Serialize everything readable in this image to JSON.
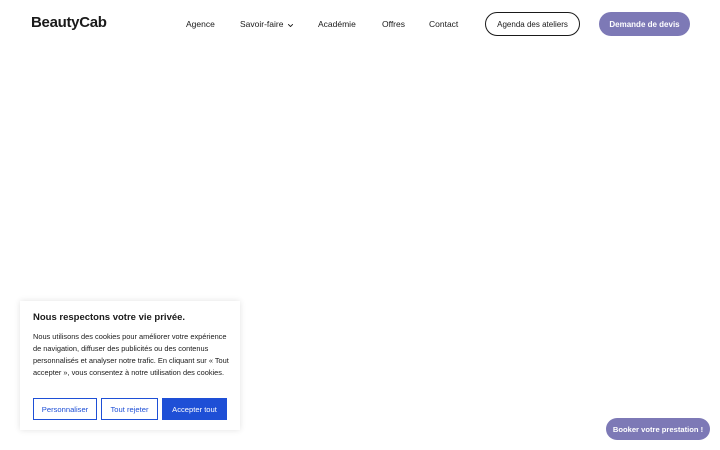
{
  "header": {
    "logo": "BeautyCab",
    "nav": {
      "agence": "Agence",
      "savoir_faire": "Savoir-faire",
      "academie": "Académie",
      "offres": "Offres",
      "contact": "Contact"
    },
    "agenda_button": "Agenda des ateliers",
    "devis_button": "Demande de devis"
  },
  "cookie_banner": {
    "title": "Nous respectons votre vie privée.",
    "text": "Nous utilisons des cookies pour améliorer votre expérience de navigation, diffuser des publicités ou des contenus personnalisés et analyser notre trafic. En cliquant sur « Tout accepter », vous consentez à notre utilisation des cookies.",
    "customize_button": "Personnaliser",
    "reject_button": "Tout rejeter",
    "accept_button": "Accepter tout"
  },
  "booking_button": "Booker votre prestation !",
  "colors": {
    "brand_purple": "#7d79b6",
    "consent_blue": "#1e4fd6",
    "text_dark": "#1a1a1a"
  },
  "icons": {
    "savoir_faire_dropdown": "chevron-down-icon"
  }
}
